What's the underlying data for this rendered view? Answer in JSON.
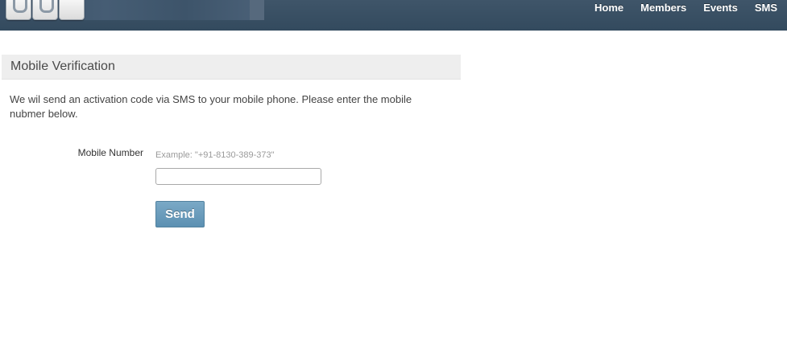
{
  "header": {
    "nav": [
      "Home",
      "Members",
      "Events",
      "SMS"
    ]
  },
  "panel": {
    "title": "Mobile Verification",
    "intro": "We wil send an activation code via SMS to your mobile phone. Please enter the mobile nubmer below."
  },
  "form": {
    "mobile_label": "Mobile Number",
    "mobile_hint": "Example: \"+91-8130-389-373\"",
    "mobile_value": "",
    "send_label": "Send"
  },
  "colors": {
    "topbar": "#3a5064",
    "button": "#6a9dbd",
    "panel_head": "#eeeeee"
  }
}
